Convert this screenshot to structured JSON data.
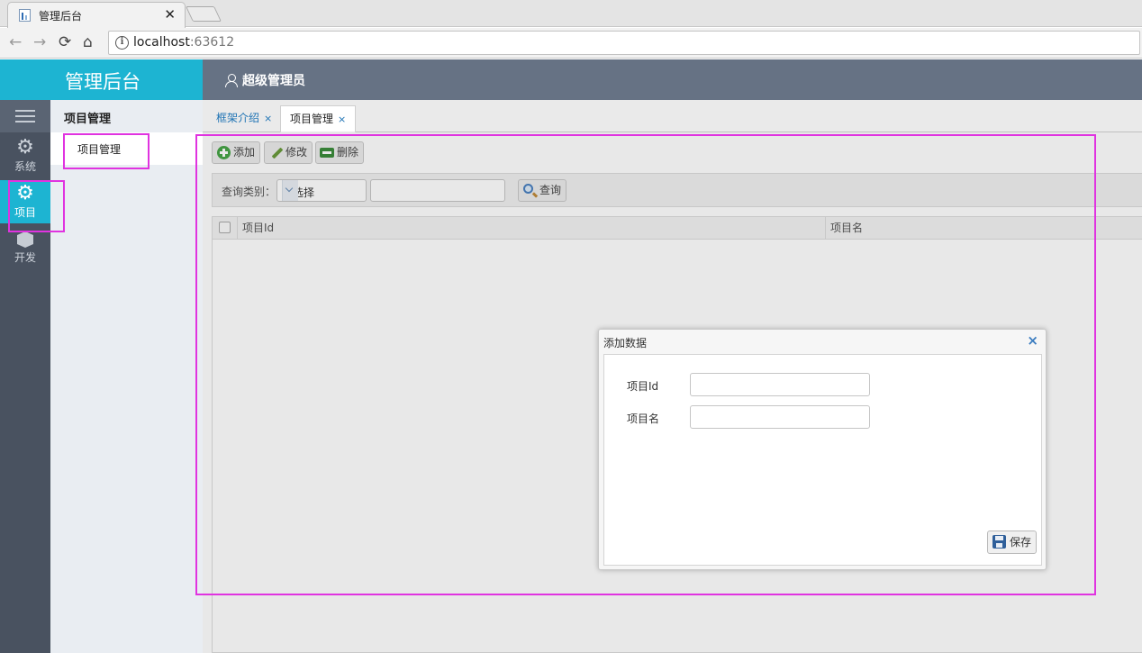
{
  "browser": {
    "tab_title": "管理后台",
    "tab_close": "✕",
    "url_host": "localhost",
    "url_port": ":63612"
  },
  "header": {
    "brand": "管理后台",
    "user": "超级管理员"
  },
  "iconbar": {
    "items": [
      {
        "label": "系统",
        "icon": "gear-icon"
      },
      {
        "label": "项目",
        "icon": "gear-icon"
      },
      {
        "label": "开发",
        "icon": "cube-icon"
      }
    ]
  },
  "subnav": {
    "heading": "项目管理",
    "items": [
      {
        "label": "项目管理"
      }
    ]
  },
  "tabs": [
    {
      "label": "框架介绍",
      "close": "×"
    },
    {
      "label": "项目管理",
      "close": "×"
    }
  ],
  "toolbar": {
    "add": "添加",
    "edit": "修改",
    "delete": "删除"
  },
  "search": {
    "label": "查询类别：",
    "select_value": "请选择",
    "button": "查询"
  },
  "grid": {
    "columns": [
      "项目Id",
      "项目名"
    ]
  },
  "dialog": {
    "title": "添加数据",
    "close": "×",
    "fields": [
      {
        "label": "项目Id",
        "value": ""
      },
      {
        "label": "项目名",
        "value": ""
      }
    ],
    "save": "保存"
  },
  "colors": {
    "brand": "#1db4d2",
    "header": "#667284",
    "iconbar": "#495260",
    "highlight": "#e033e0"
  }
}
